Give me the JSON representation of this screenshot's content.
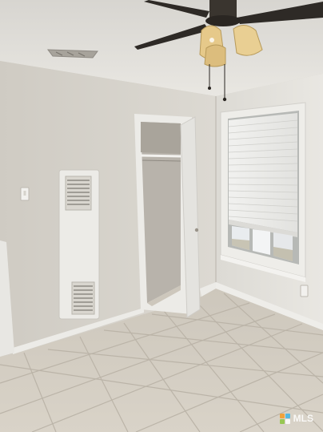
{
  "photo": {
    "subject": "empty-bedroom-interior"
  },
  "watermark": {
    "brand_text": "MLS",
    "logo_icon": "puzzle-logo-icon",
    "colors": {
      "text": "#ffffff",
      "piece_a": "#f59a23",
      "piece_b": "#3fb4e5",
      "piece_c": "#8cc63f",
      "piece_d": "#ffffff"
    }
  },
  "palette": {
    "ceiling": "#e3e1dc",
    "wall_left": "#d8d5ce",
    "wall_right": "#e4e2dc",
    "floor_tile": "#cfc9bf",
    "grout": "#b9b2a6",
    "trim": "#ecebe7",
    "fan_blade": "#2e2a26",
    "fan_globe": "#e6c98a"
  }
}
